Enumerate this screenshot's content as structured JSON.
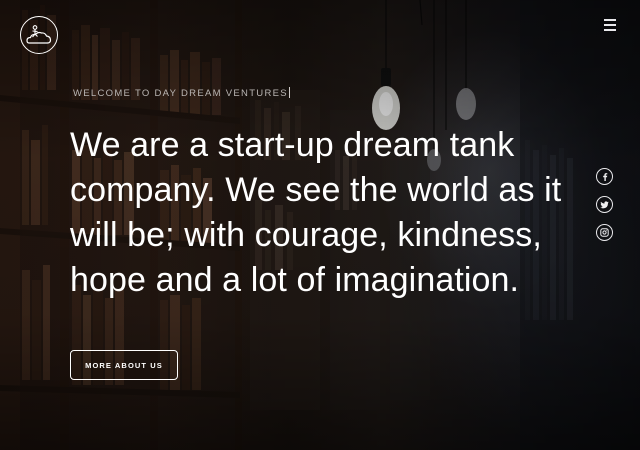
{
  "brand": {
    "logo_icon": "cloud-person-logo-icon"
  },
  "header": {
    "menu_icon": "hamburger-menu-icon"
  },
  "hero": {
    "tagline": "WELCOME TO DAY DREAM VENTURES",
    "headline_lines": [
      "We are a start-up dream tank",
      "company. We see the world as it",
      "will be; with courage, kindness,",
      "hope and a lot of imagination."
    ],
    "cta_label": "MORE ABOUT US"
  },
  "social": [
    {
      "icon": "facebook-icon",
      "glyph": "f"
    },
    {
      "icon": "twitter-icon",
      "glyph": "bird"
    },
    {
      "icon": "instagram-icon",
      "glyph": "camera"
    }
  ],
  "colors": {
    "text": "#ffffff",
    "tagline": "#b9b5b3",
    "background": "#1f1712"
  }
}
